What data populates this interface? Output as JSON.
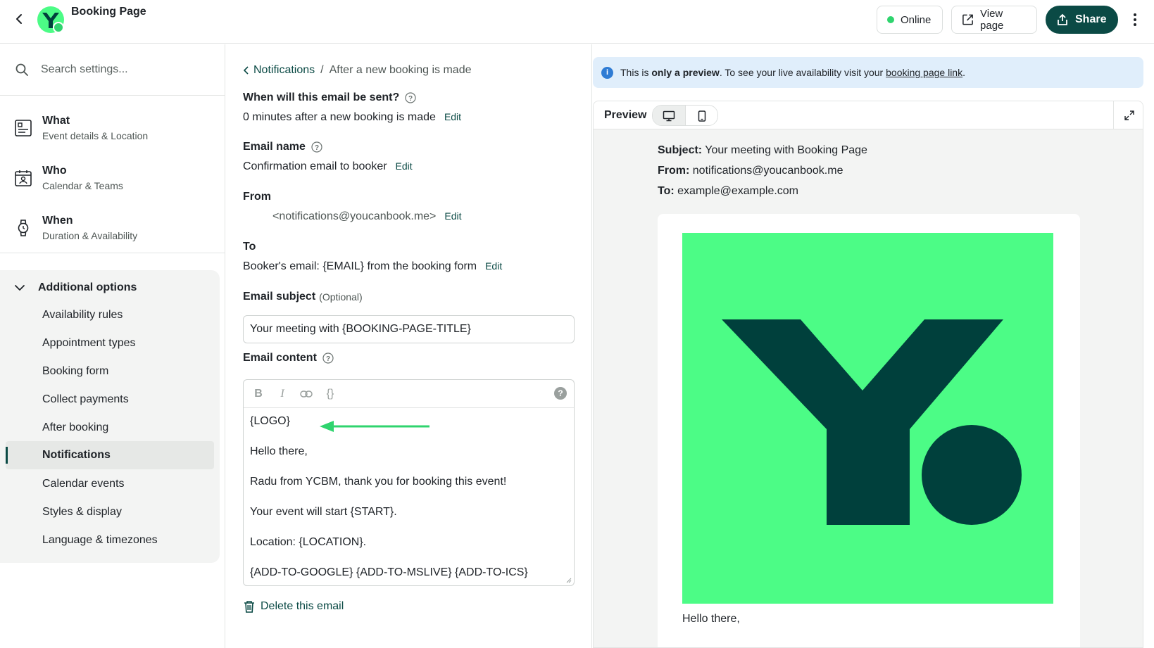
{
  "app": {
    "title": "Booking Page"
  },
  "header": {
    "online_label": "Online",
    "view_label": "View page",
    "share_label": "Share"
  },
  "sidebar": {
    "search_placeholder": "Search settings...",
    "main": [
      {
        "title": "What",
        "subtitle": "Event details & Location"
      },
      {
        "title": "Who",
        "subtitle": "Calendar & Teams"
      },
      {
        "title": "When",
        "subtitle": "Duration & Availability"
      }
    ],
    "additional": {
      "label": "Additional options",
      "items": [
        "Availability rules",
        "Appointment types",
        "Booking form",
        "Collect payments",
        "After booking",
        "Notifications",
        "Calendar events",
        "Styles & display",
        "Language & timezones"
      ],
      "active_index": 5
    }
  },
  "form": {
    "breadcrumb": {
      "parent": "Notifications",
      "separator": "/",
      "current": "After a new booking is made"
    },
    "when": {
      "label": "When will this email be sent?",
      "value": "0 minutes after a new booking is made"
    },
    "name": {
      "label": "Email name",
      "value": "Confirmation email to booker"
    },
    "from": {
      "label": "From",
      "value": "<notifications@youcanbook.me>"
    },
    "to": {
      "label": "To",
      "value": "Booker's email: {EMAIL} from the booking form"
    },
    "subject": {
      "label": "Email subject",
      "optional": "(Optional)",
      "value": "Your meeting with {BOOKING-PAGE-TITLE}"
    },
    "content": {
      "label": "Email content",
      "toolbar": {
        "bold": "B",
        "italic": "I",
        "variables": "{}",
        "help": "?"
      },
      "lines": [
        "{LOGO}",
        "Hello there,",
        "Radu from YCBM, thank you for booking this event!",
        "Your event will start {START}.",
        "Location: {LOCATION}.",
        "{ADD-TO-GOOGLE} {ADD-TO-MSLIVE} {ADD-TO-ICS}"
      ]
    },
    "edit_label": "Edit",
    "delete_label": "Delete this email"
  },
  "preview": {
    "banner": {
      "prefix": "This is ",
      "bold": "only a preview",
      "middle": ". To see your live availability visit your ",
      "link": "booking page link",
      "suffix": "."
    },
    "title": "Preview",
    "subject_label": "Subject:",
    "subject": "Your meeting with Booking Page",
    "from_label": "From:",
    "from": "notifications@youcanbook.me",
    "to_label": "To:",
    "to": "example@example.com",
    "greeting": "Hello there,"
  },
  "colors": {
    "brand_dark": "#0b4a45",
    "brand_green": "#4cfc86",
    "logo_dark": "#00403c",
    "online": "#2fd46e",
    "info": "#2f7cd4",
    "arrow": "#2fd46e"
  }
}
